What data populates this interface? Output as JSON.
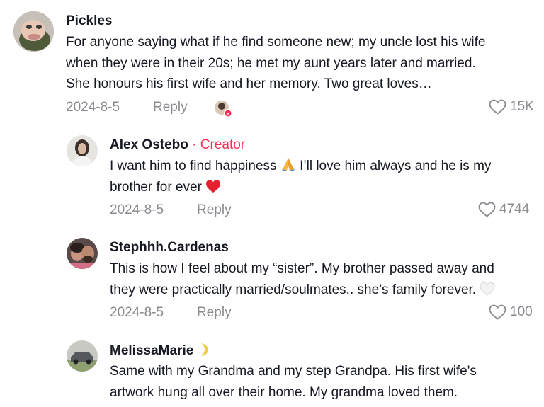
{
  "comments": [
    {
      "author": "Pickles",
      "text": "For anyone saying what if he find someone new; my uncle lost his wife when they were in their 20s; he met my aunt years later and married. She honours his first wife and her memory. Two great loves…",
      "line1": "For anyone saying what if he find someone new; my uncle lost his wife",
      "line2": "when they were in their 20s; he met my aunt years later and married.",
      "line3": "She honours his first wife and her memory. Two great loves…",
      "date": "2024-8-5",
      "reply_label": "Reply",
      "likes": "15K",
      "creator_liked": "creator-liked-avatar-icon"
    },
    {
      "author": "Alex Ostebo",
      "creator_label": "· Creator",
      "line1": "I want him to find happiness",
      "line1_tail": "I’ll love him always and he is my",
      "line2": "brother for ever",
      "emoji1": "praying-hands-icon",
      "emoji2": "red-heart-icon",
      "date": "2024-8-5",
      "reply_label": "Reply",
      "likes": "4744"
    },
    {
      "author": "Stephhh.Cardenas",
      "line1": "This is how I feel about my “sister”. My brother passed away and",
      "line2": "they were practically married/soulmates.. she’s family forever.",
      "emoji": "white-heart-icon",
      "date": "2024-8-5",
      "reply_label": "Reply",
      "likes": "100"
    },
    {
      "author": "MelissaMarie",
      "author_emoji": "crescent-moon-icon",
      "line1": "Same with my Grandma and my step Grandpa. His first wife's",
      "line2": "artwork hung all over their home. My grandma loved them."
    }
  ],
  "colors": {
    "text": "#161823",
    "muted": "#8a8b91",
    "creator": "#fe2c55"
  }
}
